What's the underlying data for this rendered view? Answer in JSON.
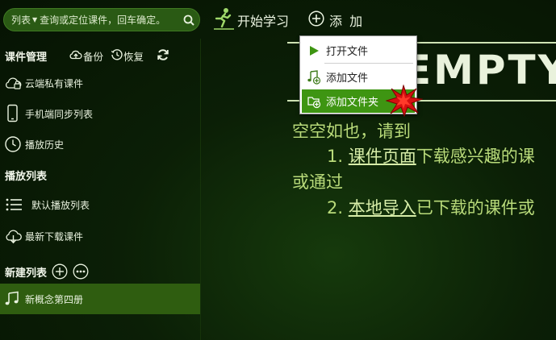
{
  "search": {
    "scope_label": "列表",
    "placeholder": "查询或定位课件，回车确定。"
  },
  "toolbar": {
    "start_label": "开始学习",
    "add_label": "添 加"
  },
  "sidebar": {
    "course_manage": {
      "title": "课件管理",
      "backup_label": "备份",
      "restore_label": "恢复"
    },
    "items_top": [
      {
        "label": "云端私有课件",
        "icon": "cloud-lock-icon"
      },
      {
        "label": "手机端同步列表",
        "icon": "phone-icon"
      },
      {
        "label": "播放历史",
        "icon": "clock-icon"
      }
    ],
    "playlist": {
      "title": "播放列表"
    },
    "items_play": [
      {
        "label": "默认播放列表",
        "icon": "list-icon"
      },
      {
        "label": "最新下载课件",
        "icon": "cloud-download-icon"
      }
    ],
    "new_list": {
      "title": "新建列表"
    },
    "items_new": [
      {
        "label": "新概念第四册",
        "icon": "music-note-icon"
      }
    ]
  },
  "main": {
    "empty_text": "EMPTY",
    "line1": "空空如也，请到",
    "line2_prefix": "1. ",
    "line2_link": "课件页面",
    "line2_suffix": "下载感兴趣的课",
    "line3": "或通过",
    "line4_prefix": "2. ",
    "line4_link": "本地导入",
    "line4_suffix": "已下载的课件或"
  },
  "menu": {
    "items": [
      {
        "label": "打开文件",
        "icon": "play-icon"
      },
      {
        "label": "添加文件",
        "icon": "add-file-icon"
      },
      {
        "label": "添加文件夹",
        "icon": "add-folder-icon"
      }
    ]
  },
  "colors": {
    "accent": "#3e9512",
    "background": "#0b1f06",
    "message": "#b9db7a"
  }
}
